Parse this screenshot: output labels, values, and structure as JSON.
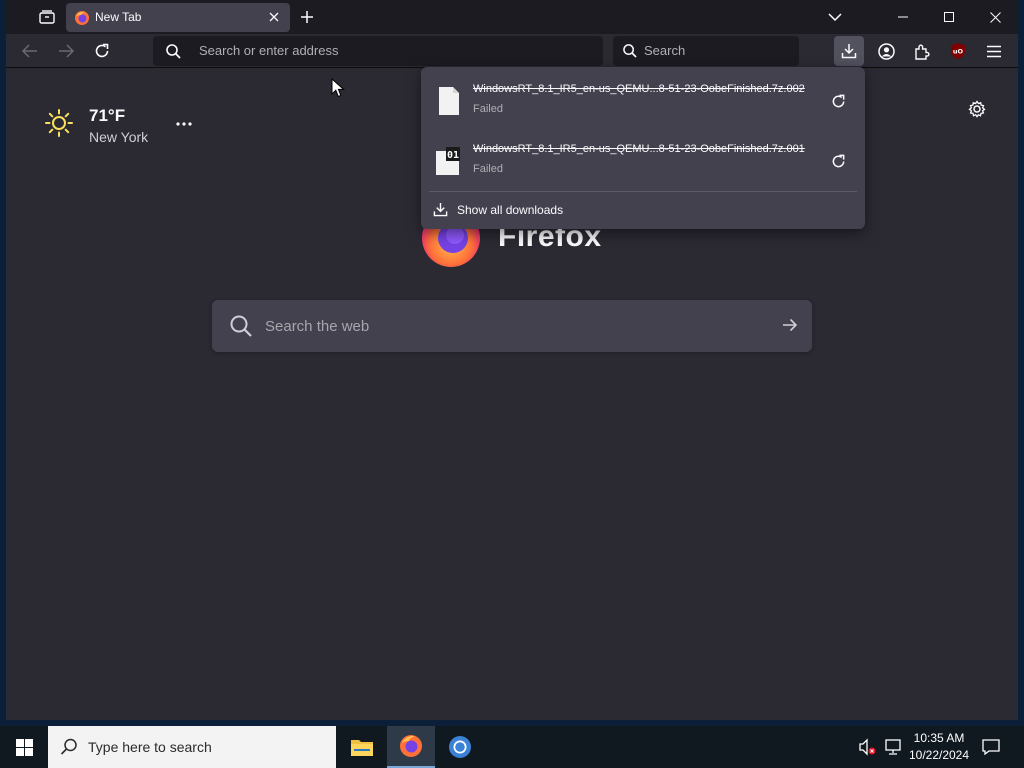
{
  "browser": {
    "tab": {
      "title": "New Tab"
    },
    "urlbar": {
      "placeholder": "Search or enter address"
    },
    "searchbar": {
      "placeholder": "Search"
    }
  },
  "newtab": {
    "weather": {
      "temperature": "71°F",
      "city": "New York"
    },
    "brand": "Firefox",
    "search_placeholder": "Search the web"
  },
  "downloads_panel": {
    "items": [
      {
        "filename": "WindowsRT_8.1_IR5_en-us_QEMU...8-51-23-OobeFinished.7z.002",
        "status": "Failed",
        "icon": "blank-file-icon"
      },
      {
        "filename": "WindowsRT_8.1_IR5_en-us_QEMU...8-51-23-OobeFinished.7z.001",
        "status": "Failed",
        "icon": "binary-file-icon"
      }
    ],
    "show_all": "Show all downloads"
  },
  "taskbar": {
    "search_placeholder": "Type here to search",
    "apps": [
      "file-explorer-icon",
      "firefox-icon",
      "chromium-icon"
    ],
    "time": "10:35 AM",
    "date": "10/22/2024"
  },
  "colors": {
    "content_bg": "#2b2a33",
    "tab_strip_bg": "#1c1b22",
    "panel_bg": "#42414d",
    "accent_weather": "#fbe05b"
  }
}
